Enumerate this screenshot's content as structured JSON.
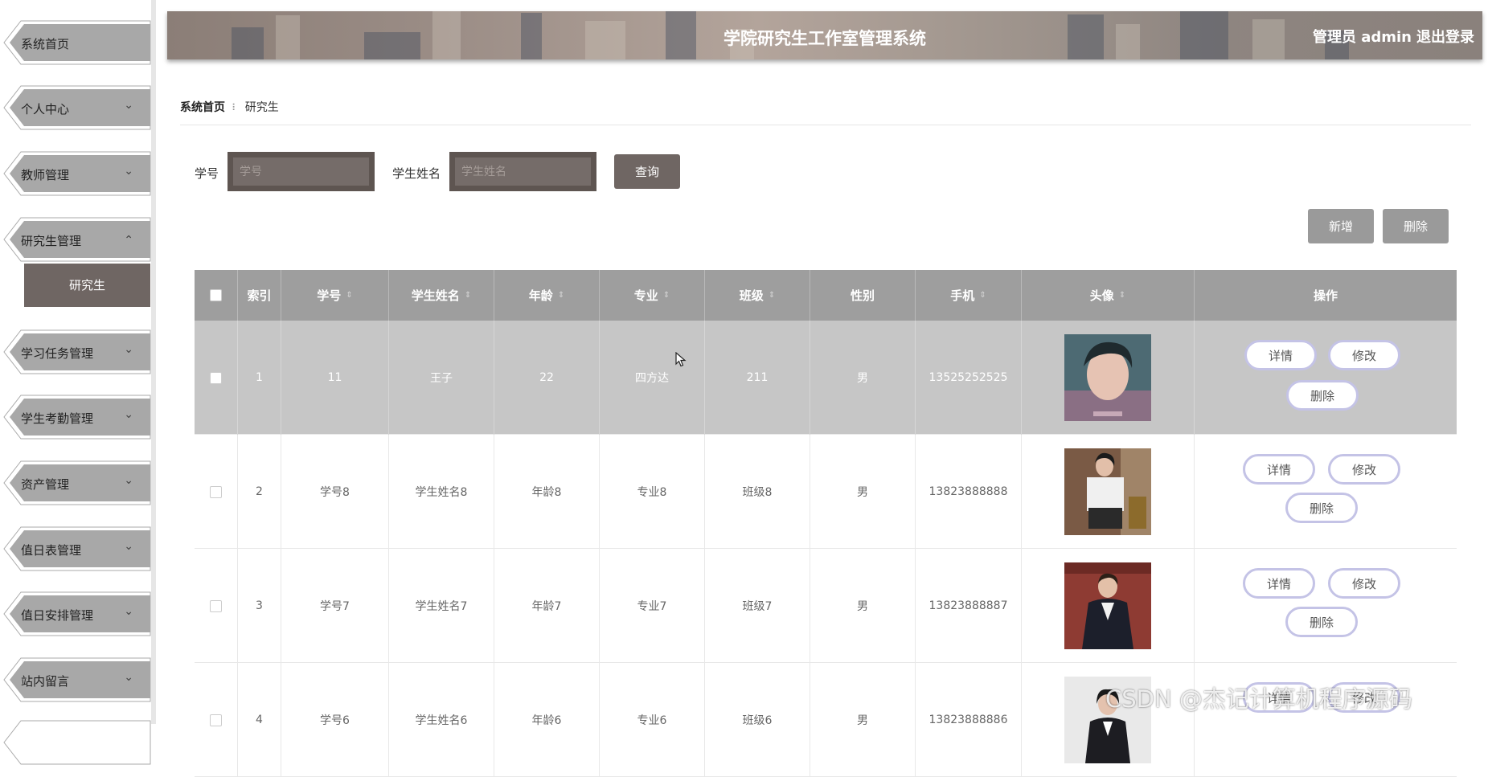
{
  "sidebar": {
    "items": [
      {
        "label": "系统首页",
        "has_chevron": false
      },
      {
        "label": "个人中心",
        "has_chevron": true
      },
      {
        "label": "教师管理",
        "has_chevron": true
      },
      {
        "label": "研究生管理",
        "has_chevron": true,
        "expanded": true
      },
      {
        "label": "学习任务管理",
        "has_chevron": true
      },
      {
        "label": "学生考勤管理",
        "has_chevron": true
      },
      {
        "label": "资产管理",
        "has_chevron": true
      },
      {
        "label": "值日表管理",
        "has_chevron": true
      },
      {
        "label": "值日安排管理",
        "has_chevron": true
      },
      {
        "label": "站内留言",
        "has_chevron": true
      }
    ],
    "submenu_active": "研究生",
    "chevron_down": "⌄",
    "chevron_up": "⌃"
  },
  "header": {
    "title": "学院研究生工作室管理系统",
    "user": "管理员 admin",
    "logout": "退出登录"
  },
  "breadcrumb": {
    "home": "系统首页",
    "separator": "⠇",
    "current": "研究生"
  },
  "search": {
    "field1_label": "学号",
    "field1_placeholder": "学号",
    "field2_label": "学生姓名",
    "field2_placeholder": "学生姓名",
    "query_button": "查询"
  },
  "actions": {
    "add": "新增",
    "delete": "删除"
  },
  "table": {
    "columns": [
      "索引",
      "学号",
      "学生姓名",
      "年龄",
      "专业",
      "班级",
      "性别",
      "手机",
      "头像",
      "操作"
    ],
    "sortable": [
      false,
      true,
      true,
      true,
      true,
      true,
      false,
      true,
      true,
      false
    ],
    "sort_icon": "⇕",
    "row_buttons": {
      "detail": "详情",
      "edit": "修改",
      "delete": "删除"
    },
    "rows": [
      {
        "index": "1",
        "student_no": "11",
        "name": "王子",
        "age": "22",
        "major": "四方达",
        "class": "211",
        "gender": "男",
        "phone": "13525252525",
        "avatar": "avatar-young-man-portrait"
      },
      {
        "index": "2",
        "student_no": "学号8",
        "name": "学生姓名8",
        "age": "年龄8",
        "major": "专业8",
        "class": "班级8",
        "gender": "男",
        "phone": "13823888888",
        "avatar": "avatar-woman-office-uniform"
      },
      {
        "index": "3",
        "student_no": "学号7",
        "name": "学生姓名7",
        "age": "年龄7",
        "major": "专业7",
        "class": "班级7",
        "gender": "男",
        "phone": "13823888887",
        "avatar": "avatar-man-suit"
      },
      {
        "index": "4",
        "student_no": "学号6",
        "name": "学生姓名6",
        "age": "年龄6",
        "major": "专业6",
        "class": "班级6",
        "gender": "男",
        "phone": "13823888886",
        "avatar": "avatar-woman-suit"
      }
    ]
  },
  "watermark": "CSDN @杰记计算机程序源码",
  "colors": {
    "accent": "#6f6663",
    "header_bar": "#9e9e9e",
    "highlight_row": "#c6c6c6",
    "pill_border": "#c4c3e6"
  }
}
